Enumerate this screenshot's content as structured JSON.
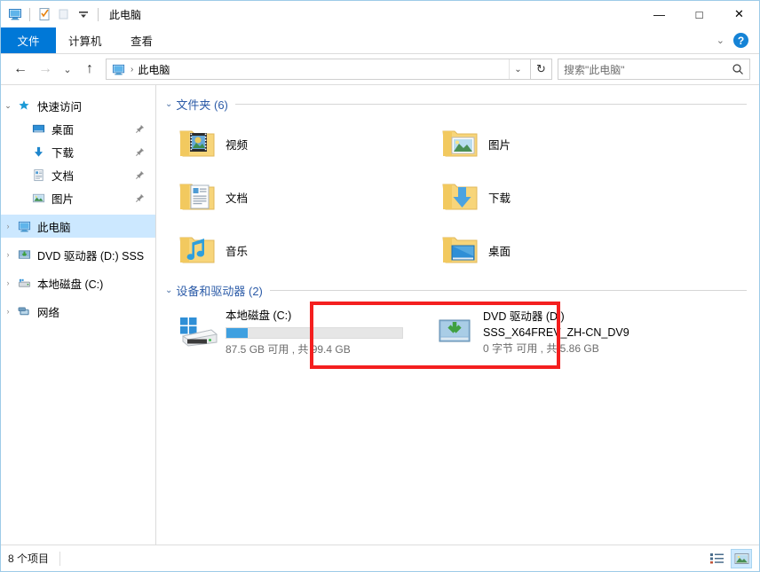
{
  "window": {
    "title": "此电脑",
    "quick_access": [
      {
        "name": "this-pc-icon",
        "label": "此电脑"
      },
      {
        "name": "properties-icon",
        "label": "属性"
      },
      {
        "name": "new-folder-icon",
        "label": "新建文件夹"
      },
      {
        "name": "customize-qat-chevron-icon",
        "label": "自定义快速访问工具栏"
      }
    ],
    "controls": {
      "minimize": "—",
      "maximize": "□",
      "close": "✕"
    }
  },
  "ribbon": {
    "tabs": [
      {
        "label": "文件",
        "active": true
      },
      {
        "label": "计算机",
        "active": false
      },
      {
        "label": "查看",
        "active": false
      }
    ],
    "collapse_chevron": "⌄",
    "help_label": "?"
  },
  "navbar": {
    "back": "←",
    "forward": "→",
    "history": "⌄",
    "up": "↑",
    "breadcrumb": {
      "icon": "this-pc-icon",
      "separator": "›",
      "text": "此电脑"
    },
    "address_dropdown": "⌄",
    "refresh": "↻"
  },
  "search": {
    "placeholder": "搜索\"此电脑\"",
    "icon": "search-icon"
  },
  "sidebar": {
    "items": [
      {
        "label": "快速访问",
        "icon": "star-icon",
        "chevron": "⌄",
        "expanded": true,
        "child": false,
        "pinned": false,
        "selected": false
      },
      {
        "label": "桌面",
        "icon": "desktop-icon",
        "chevron": "",
        "expanded": false,
        "child": true,
        "pinned": true,
        "selected": false
      },
      {
        "label": "下载",
        "icon": "downloads-icon",
        "chevron": "",
        "expanded": false,
        "child": true,
        "pinned": true,
        "selected": false
      },
      {
        "label": "文档",
        "icon": "documents-icon",
        "chevron": "",
        "expanded": false,
        "child": true,
        "pinned": true,
        "selected": false
      },
      {
        "label": "图片",
        "icon": "pictures-icon",
        "chevron": "",
        "expanded": false,
        "child": true,
        "pinned": true,
        "selected": false
      },
      {
        "label": "此电脑",
        "icon": "this-pc-icon",
        "chevron": "›",
        "expanded": false,
        "child": false,
        "pinned": false,
        "selected": true
      },
      {
        "label": "DVD 驱动器 (D:) SSS",
        "icon": "dvd-drive-icon",
        "chevron": "›",
        "expanded": false,
        "child": false,
        "pinned": false,
        "selected": false
      },
      {
        "label": "本地磁盘 (C:)",
        "icon": "hard-drive-icon",
        "chevron": "›",
        "expanded": false,
        "child": false,
        "pinned": false,
        "selected": false
      },
      {
        "label": "网络",
        "icon": "network-icon",
        "chevron": "›",
        "expanded": false,
        "child": false,
        "pinned": false,
        "selected": false
      }
    ],
    "pin_glyph": "📌"
  },
  "main": {
    "folders_group": {
      "chevron": "⌄",
      "title": "文件夹 (6)",
      "items": [
        {
          "label": "视频",
          "icon": "videos-folder-icon"
        },
        {
          "label": "图片",
          "icon": "pictures-folder-icon"
        },
        {
          "label": "文档",
          "icon": "documents-folder-icon"
        },
        {
          "label": "下载",
          "icon": "downloads-folder-icon"
        },
        {
          "label": "音乐",
          "icon": "music-folder-icon"
        },
        {
          "label": "桌面",
          "icon": "desktop-folder-icon"
        }
      ]
    },
    "devices_group": {
      "chevron": "⌄",
      "title": "设备和驱动器 (2)",
      "drives": [
        {
          "name": "本地磁盘 (C:)",
          "icon": "windows-drive-icon",
          "has_bar": true,
          "used_percent": 12,
          "capacity_text": "87.5 GB 可用 , 共 99.4 GB",
          "free_gb": 87.5,
          "total_gb": 99.4,
          "highlighted": true
        },
        {
          "name": "DVD 驱动器 (D:)",
          "icon": "dvd-drive-icon",
          "has_bar": false,
          "volume_label": "SSS_X64FREV_ZH-CN_DV9",
          "capacity_text": "0 字节 可用 , 共 5.86 GB",
          "free_gb": 0,
          "total_gb": 5.86,
          "highlighted": false
        }
      ]
    }
  },
  "statusbar": {
    "item_count": "8 个项目",
    "view_buttons": [
      {
        "name": "details-view-button",
        "active": false
      },
      {
        "name": "large-icons-view-button",
        "active": true
      }
    ]
  },
  "colors": {
    "accent": "#0078d7",
    "selection": "#cce8ff",
    "group_title": "#2d5ca8",
    "annotation_red": "#f41f1f",
    "drive_bar_fill": "#3fa0e0"
  }
}
